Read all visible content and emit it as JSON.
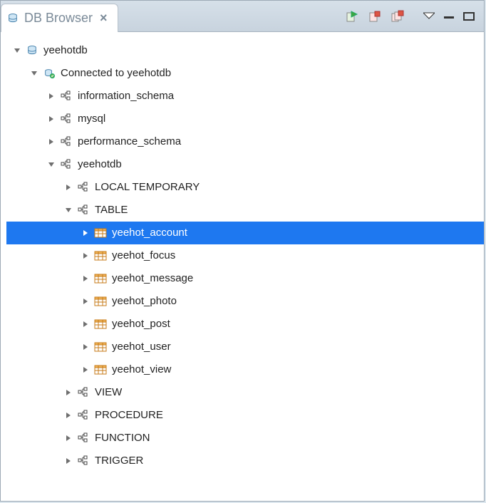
{
  "tab": {
    "title": "DB Browser"
  },
  "tree": {
    "root": {
      "label": "yeehotdb",
      "connection": {
        "label": "Connected to yeehotdb"
      },
      "schemas": [
        {
          "label": "information_schema"
        },
        {
          "label": "mysql"
        },
        {
          "label": "performance_schema"
        }
      ],
      "open_schema": {
        "label": "yeehotdb",
        "folders": {
          "local_temporary": "LOCAL TEMPORARY",
          "table": "TABLE",
          "view": "VIEW",
          "procedure": "PROCEDURE",
          "function": "FUNCTION",
          "trigger": "TRIGGER"
        },
        "tables": [
          {
            "label": "yeehot_account",
            "selected": true
          },
          {
            "label": "yeehot_focus"
          },
          {
            "label": "yeehot_message"
          },
          {
            "label": "yeehot_photo"
          },
          {
            "label": "yeehot_post"
          },
          {
            "label": "yeehot_user"
          },
          {
            "label": "yeehot_view"
          }
        ]
      }
    }
  }
}
